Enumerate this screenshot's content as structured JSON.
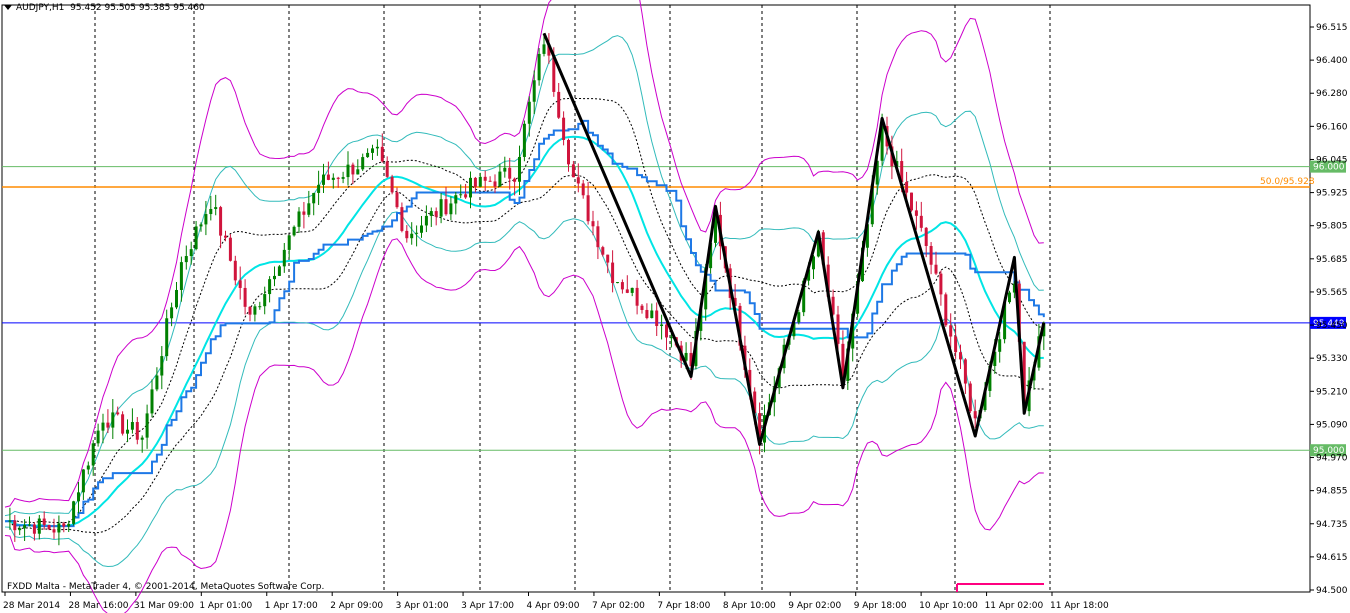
{
  "header": {
    "symbol": "AUDJPY,H1",
    "ohlc": "95.452 95.505 95.385 95.460"
  },
  "footer": {
    "copyright": "FXDD Malta - MetaTrader 4, © 2001-2014, MetaQuotes Software Corp."
  },
  "colors": {
    "background": "#ffffff",
    "bull_candle": "#008000",
    "bear_candle": "#d0143c",
    "kijun": "#1e78e6",
    "ma_cyan": "#00e5e5",
    "band_outer": "#cc00cc",
    "band_inner": "#33bbbb",
    "fib_line": "#ff8c00",
    "price_line": "#0000ff",
    "level_line": "#66bb66",
    "zigzag": "#000000",
    "marker": "#ff0080"
  },
  "chart_data": {
    "type": "candlestick",
    "ylim": [
      94.5,
      96.57
    ],
    "y_ticks": [
      "96.515",
      "96.400",
      "96.280",
      "96.160",
      "96.045",
      "95.925",
      "95.805",
      "95.685",
      "95.565",
      "95.450",
      "95.330",
      "95.210",
      "95.090",
      "94.970",
      "94.855",
      "94.735",
      "94.615",
      "94.500"
    ],
    "x_ticks": [
      "28 Mar 2014",
      "28 Mar 16:00",
      "31 Mar 09:00",
      "1 Apr 01:00",
      "1 Apr 17:00",
      "2 Apr 09:00",
      "3 Apr 01:00",
      "3 Apr 17:00",
      "4 Apr 09:00",
      "7 Apr 02:00",
      "7 Apr 18:00",
      "8 Apr 10:00",
      "9 Apr 02:00",
      "9 Apr 18:00",
      "10 Apr 10:00",
      "11 Apr 02:00",
      "11 Apr 18:00"
    ],
    "day_separators": [
      "31 Mar",
      "1 Apr",
      "2 Apr",
      "3 Apr",
      "4 Apr",
      "7 Apr",
      "8 Apr",
      "9 Apr",
      "10 Apr",
      "11 Apr"
    ],
    "bars": 210,
    "horizontal_levels": [
      {
        "value": 96.0,
        "label": "96.000"
      },
      {
        "value": 95.0,
        "label": "95.000"
      }
    ],
    "fib_level": {
      "value": 95.928,
      "label": "50.0/95.928"
    },
    "current_price": {
      "value": 95.449,
      "label": "95.449"
    },
    "zigzag": [
      {
        "bar": 110,
        "price": 96.47
      },
      {
        "bar": 140,
        "price": 95.26
      },
      {
        "bar": 145,
        "price": 95.86
      },
      {
        "bar": 154,
        "price": 95.02
      },
      {
        "bar": 166,
        "price": 95.77
      },
      {
        "bar": 171,
        "price": 95.22
      },
      {
        "bar": 179,
        "price": 96.17
      },
      {
        "bar": 198,
        "price": 95.05
      },
      {
        "bar": 206,
        "price": 95.68
      },
      {
        "bar": 208,
        "price": 95.13
      },
      {
        "bar": 212,
        "price": 95.45
      }
    ],
    "close_path": [
      {
        "bar": 0,
        "price": 94.75
      },
      {
        "bar": 12,
        "price": 94.72
      },
      {
        "bar": 20,
        "price": 95.12
      },
      {
        "bar": 28,
        "price": 95.05
      },
      {
        "bar": 36,
        "price": 95.66
      },
      {
        "bar": 42,
        "price": 95.88
      },
      {
        "bar": 50,
        "price": 95.46
      },
      {
        "bar": 56,
        "price": 95.68
      },
      {
        "bar": 64,
        "price": 95.94
      },
      {
        "bar": 76,
        "price": 96.04
      },
      {
        "bar": 82,
        "price": 95.76
      },
      {
        "bar": 94,
        "price": 95.92
      },
      {
        "bar": 104,
        "price": 95.98
      },
      {
        "bar": 110,
        "price": 96.45
      },
      {
        "bar": 116,
        "price": 95.96
      },
      {
        "bar": 124,
        "price": 95.62
      },
      {
        "bar": 134,
        "price": 95.45
      },
      {
        "bar": 140,
        "price": 95.3
      },
      {
        "bar": 145,
        "price": 95.82
      },
      {
        "bar": 154,
        "price": 95.06
      },
      {
        "bar": 166,
        "price": 95.74
      },
      {
        "bar": 171,
        "price": 95.25
      },
      {
        "bar": 179,
        "price": 96.12
      },
      {
        "bar": 188,
        "price": 95.72
      },
      {
        "bar": 198,
        "price": 95.1
      },
      {
        "bar": 206,
        "price": 95.62
      },
      {
        "bar": 208,
        "price": 95.16
      },
      {
        "bar": 212,
        "price": 95.46
      }
    ]
  }
}
